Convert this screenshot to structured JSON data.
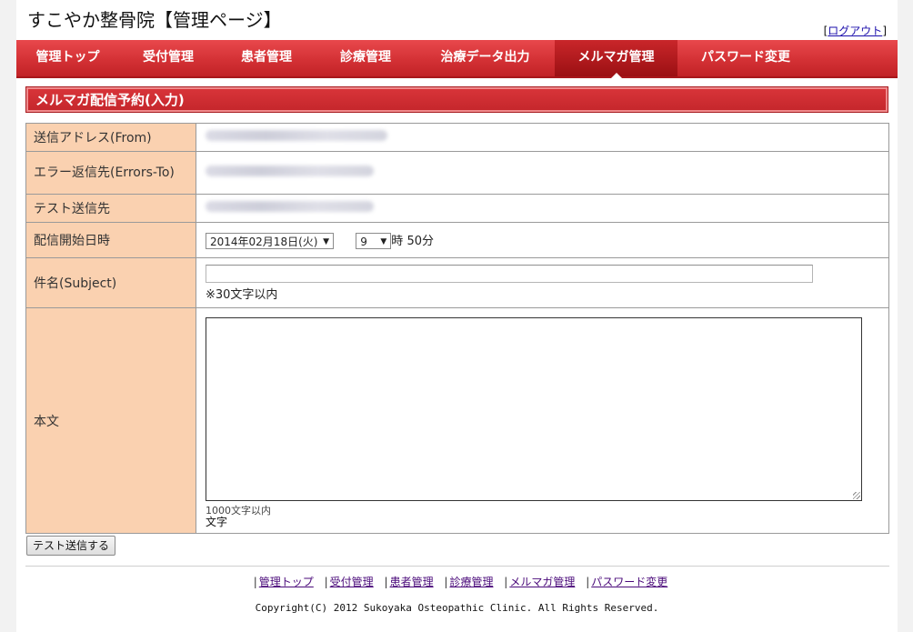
{
  "site": {
    "title": "すこやか整骨院【管理ページ】",
    "logout_prefix": "[",
    "logout_label": "ログアウト",
    "logout_suffix": "]"
  },
  "nav": {
    "items": [
      {
        "label": "管理トップ"
      },
      {
        "label": "受付管理"
      },
      {
        "label": "患者管理"
      },
      {
        "label": "診療管理"
      },
      {
        "label": "治療データ出力"
      },
      {
        "label": "メルマガ管理",
        "active": true
      },
      {
        "label": "パスワード変更"
      }
    ]
  },
  "section": {
    "title": "メルマガ配信予約(入力)"
  },
  "form": {
    "from_label": "送信アドレス(From)",
    "errors_to_label": "エラー返信先(Errors-To)",
    "test_to_label": "テスト送信先",
    "schedule_label": "配信開始日時",
    "date_value": "2014年02月18日(火)",
    "hour_value": "9",
    "hour_unit": "時",
    "minute_text": "50分",
    "subject_label": "件名(Subject)",
    "subject_value": "",
    "subject_note": "※30文字以内",
    "body_label": "本文",
    "body_note": "1000文字以内",
    "body_count_label": "文字",
    "test_send_button": "テスト送信する"
  },
  "footer": {
    "links": [
      "管理トップ",
      "受付管理",
      "患者管理",
      "診療管理",
      "メルマガ管理",
      "パスワード変更"
    ],
    "separator": "|",
    "copyright": "Copyright(C) 2012 Sukoyaka Osteopathic Clinic. All Rights Reserved."
  },
  "colors": {
    "nav_red": "#d43135",
    "label_bg": "#fad1b0",
    "header_red": "#c4262b"
  }
}
